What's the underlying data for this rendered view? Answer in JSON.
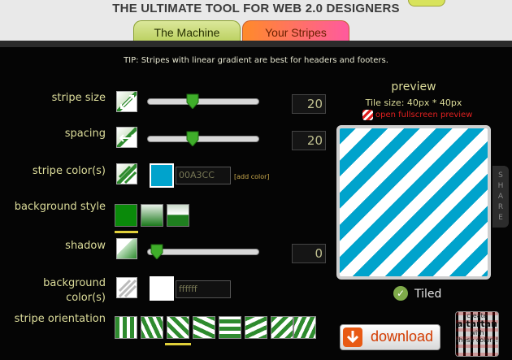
{
  "header": {
    "title": "THE ULTIMATE TOOL FOR WEB 2.0 DESIGNERS"
  },
  "tabs": [
    {
      "label": "The Machine",
      "active": true
    },
    {
      "label": "Your Stripes",
      "active": false
    }
  ],
  "tip": "TIP: Stripes with linear gradient are best for headers and footers.",
  "controls": {
    "stripe_size": {
      "label": "stripe size",
      "value": "20",
      "fraction": 0.42
    },
    "spacing": {
      "label": "spacing",
      "value": "20",
      "fraction": 0.42
    },
    "stripe_color": {
      "label": "stripe color(s)",
      "hex": "00A3CC",
      "swatch": "#00a3cc",
      "add_label": "[add color]"
    },
    "background_style": {
      "label": "background style",
      "selected_index": 0
    },
    "shadow": {
      "label": "shadow",
      "value": "0",
      "fraction": 0.0
    },
    "background_color": {
      "label": "background color(s)",
      "hex": "ffffff",
      "swatch": "#ffffff"
    },
    "stripe_orientation": {
      "label": "stripe orientation",
      "selected_index": 2
    }
  },
  "preview": {
    "title": "preview",
    "tile_size": "Tile size: 40px * 40px",
    "fullscreen_link": "open fullscreen preview",
    "share_label": "SHARE",
    "tiled_label": "Tiled",
    "tiled_checked": true
  },
  "actions": {
    "download_label": "download",
    "tartan_line1": "create",
    "tartan_line2": "a tartan",
    "tartan_line3": "with",
    "tartan_line4": "these colors!"
  },
  "colors": {
    "stripe": "#00a3cc",
    "background": "#ffffff",
    "label_text": "#dcdc9a",
    "accent_green": "#2e8b2e"
  }
}
